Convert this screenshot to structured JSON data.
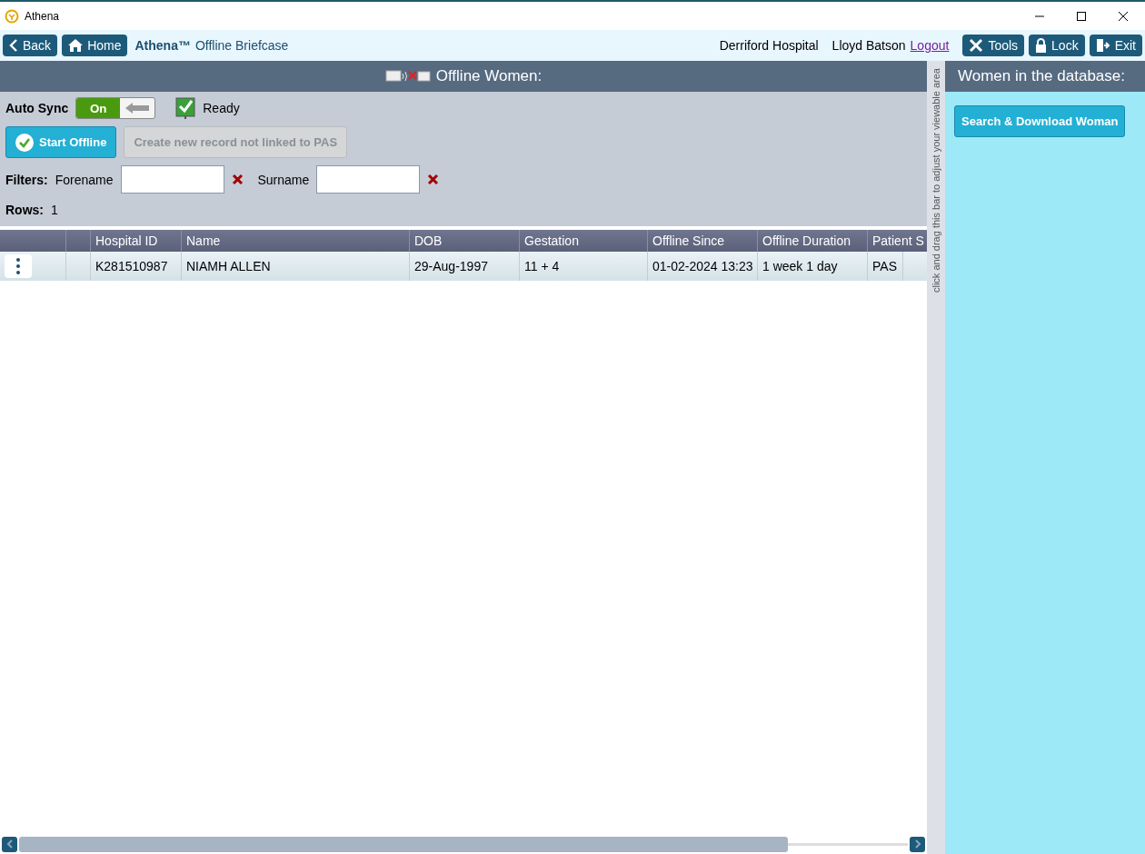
{
  "window": {
    "title": "Athena"
  },
  "toolbar": {
    "nav_buttons": [
      {
        "kind": "back",
        "label": "Back"
      },
      {
        "kind": "home",
        "label": "Home"
      }
    ],
    "app_name": "Athena™",
    "page_title": "Offline Briefcase",
    "location": "Derriford Hospital",
    "user": "Lloyd Batson",
    "logout": "Logout",
    "actions": [
      {
        "kind": "tools",
        "label": "Tools"
      },
      {
        "kind": "lock",
        "label": "Lock"
      },
      {
        "kind": "exit",
        "label": "Exit"
      }
    ]
  },
  "main_panel": {
    "title": "Offline Women:",
    "auto_sync": {
      "label": "Auto Sync",
      "on": true,
      "value": "On"
    },
    "ready": {
      "label": "Ready",
      "checked": true
    },
    "buttons": [
      {
        "label": "Start Offline",
        "disabled": false
      },
      {
        "label": "Create new record not linked to PAS",
        "disabled": true
      }
    ],
    "filters": {
      "label": "Filters:",
      "fields": [
        {
          "label": "Forename"
        },
        {
          "label": "Surname"
        }
      ]
    },
    "rows_count": {
      "label": "Rows:",
      "value": "1"
    },
    "table": {
      "columns": [
        "Hospital ID",
        "Name",
        "DOB",
        "Gestation",
        "Offline Since",
        "Offline Duration",
        "Patient S"
      ],
      "rows": [
        {
          "cells": [
            "K281510987",
            "NIAMH ALLEN",
            "29-Aug-1997",
            "11 + 4",
            "01-02-2024 13:23",
            "1 week 1 day",
            "PAS"
          ]
        }
      ]
    }
  },
  "splitter": {
    "hint": "click and drag this bar to adjust your viewable area"
  },
  "side_panel": {
    "title": "Women in the database:",
    "button": "Search & Download Woman"
  }
}
